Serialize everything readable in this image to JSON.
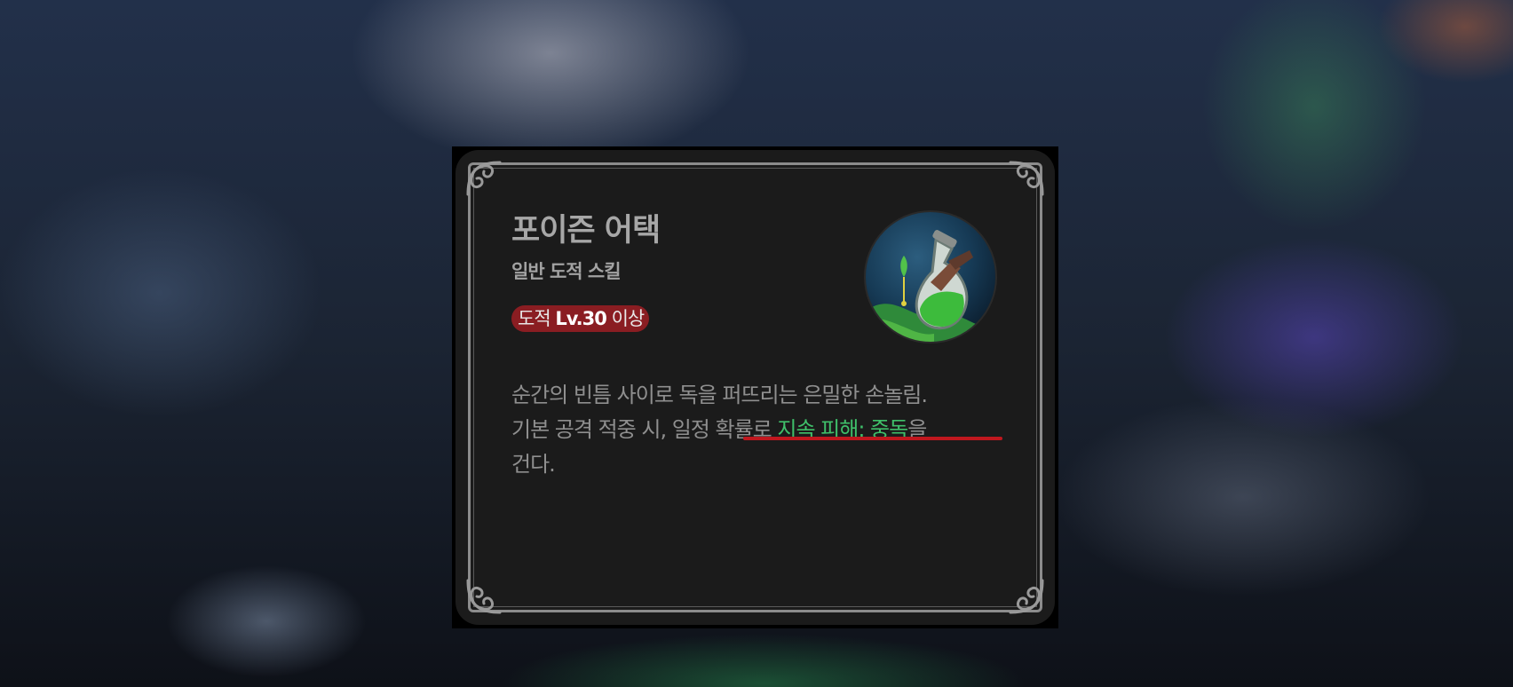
{
  "skill": {
    "name": "포이즌 어택",
    "category": "일반 도적 스킬",
    "requirement": {
      "class": "도적",
      "level": "Lv.30",
      "suffix": "이상"
    },
    "icon": "poison-flask-icon",
    "description": {
      "line1": "순간의 빈틈 사이로 독을 퍼뜨리는 은밀한 손놀림.",
      "line2_prefix": "기본 공격 적중 시, ",
      "line2_highlight_plain": "일정 확률로 ",
      "line2_highlight_green": "지속 피해: 중독",
      "line2_suffix": "을",
      "line3": "건다."
    }
  },
  "colors": {
    "card": "#1b1b1b",
    "badge": "#8a1d22",
    "effect_green": "#3fbf6a",
    "underline": "#c0171e"
  }
}
